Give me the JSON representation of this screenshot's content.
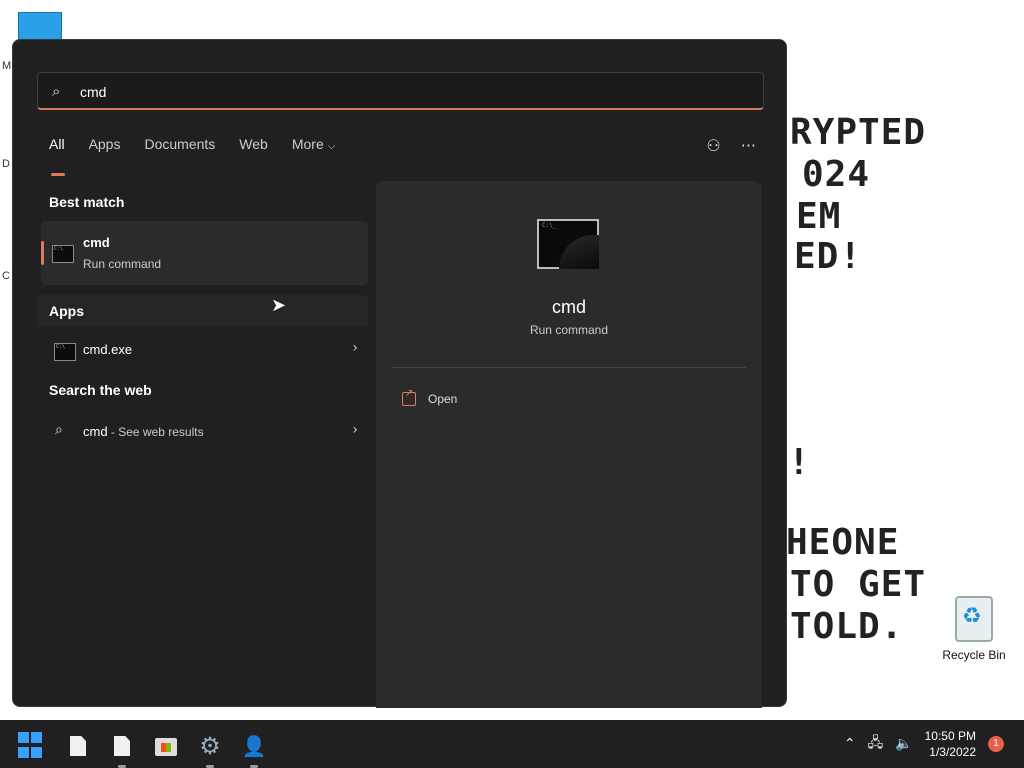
{
  "desktop": {
    "bg_lines": [
      "RYPTED",
      "024",
      "EM",
      "ED!",
      "!",
      "HEONE",
      "TO GET",
      "TOLD."
    ],
    "edge_letters": [
      "M",
      "D",
      "C"
    ],
    "recycle_bin_label": "Recycle Bin"
  },
  "search": {
    "value": "cmd",
    "tabs": [
      {
        "label": "All"
      },
      {
        "label": "Apps"
      },
      {
        "label": "Documents"
      },
      {
        "label": "Web"
      },
      {
        "label": "More"
      }
    ],
    "more_chevron": "⌵",
    "top_icons": [
      "people-search-icon",
      "more-options-icon"
    ]
  },
  "results": {
    "best_match_title": "Best match",
    "best_match": {
      "name": "cmd",
      "subtitle": "Run command"
    },
    "apps_title": "Apps",
    "apps": [
      {
        "name": "cmd.exe"
      }
    ],
    "web_title": "Search the web",
    "web": {
      "query": "cmd",
      "suffix": " - See web results"
    }
  },
  "preview": {
    "name": "cmd",
    "subtitle": "Run command",
    "actions": [
      {
        "label": "Open"
      }
    ]
  },
  "taskbar": {
    "icons": [
      "windows-start-icon",
      "file-icon",
      "file-icon",
      "store-icon",
      "settings-icon",
      "people-icon"
    ],
    "time": "10:50 PM",
    "date": "1/3/2022",
    "notification_count": "1"
  },
  "colors": {
    "accent": "#e07a5f",
    "panel_bg": "#202020",
    "card_bg": "#2b2b2b",
    "taskbar_bg": "#202020"
  }
}
